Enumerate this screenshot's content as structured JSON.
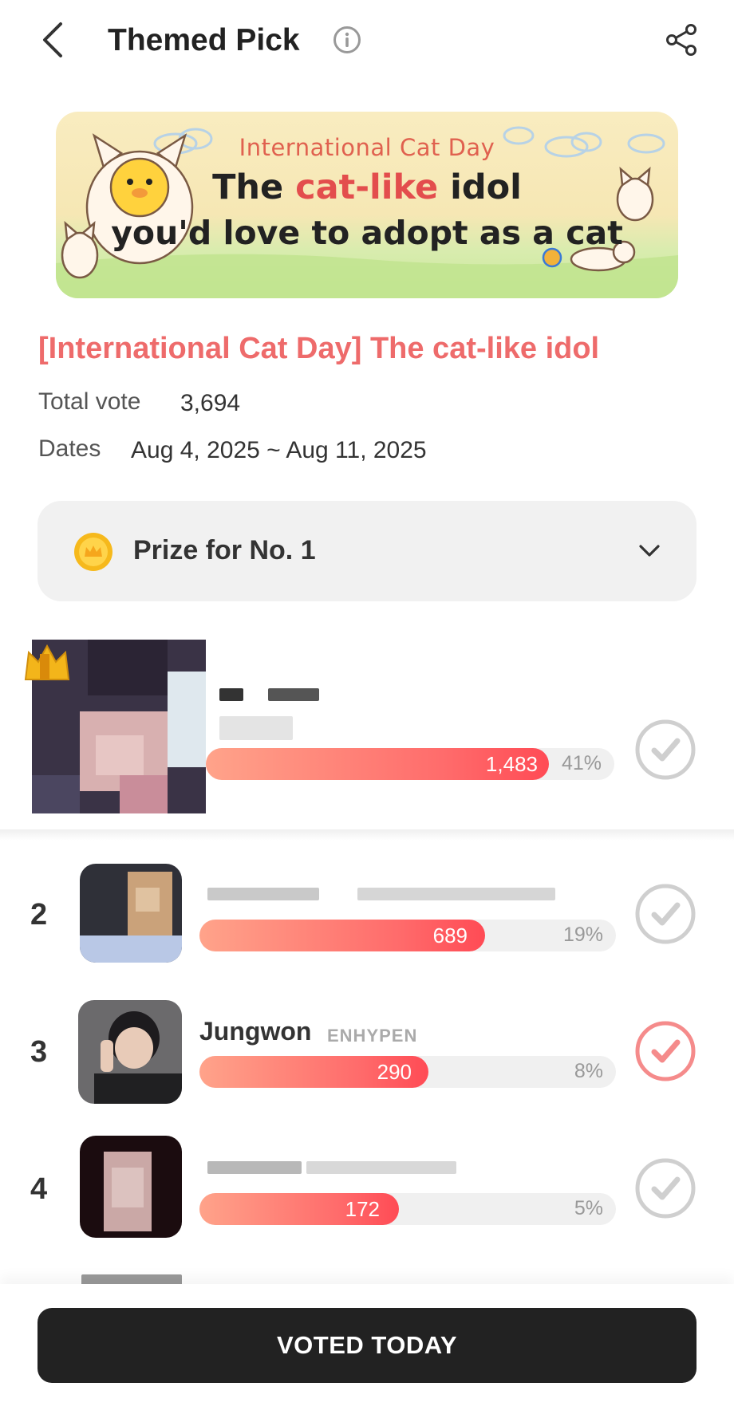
{
  "header": {
    "title": "Themed Pick"
  },
  "banner": {
    "line1": "International Cat Day",
    "line2_a": "The ",
    "line2_hl": "cat-like",
    "line2_b": " idol",
    "line3": "you'd love to adopt as a cat"
  },
  "pick": {
    "title": "[International Cat Day] The cat-like idol",
    "total_label": "Total vote",
    "total_value": "3,694",
    "dates_label": "Dates",
    "dates_value": "Aug 4, 2025 ~ Aug 11, 2025"
  },
  "prize": {
    "label": "Prize for No. 1"
  },
  "entries": [
    {
      "rank": "1",
      "name": "",
      "group": "",
      "votes": "1,483",
      "percent": "41%",
      "fraction": 0.41,
      "voted": false
    },
    {
      "rank": "2",
      "name": "",
      "group": "",
      "votes": "689",
      "percent": "19%",
      "fraction": 0.19,
      "voted": false
    },
    {
      "rank": "3",
      "name": "Jungwon",
      "group": "ENHYPEN",
      "votes": "290",
      "percent": "8%",
      "fraction": 0.08,
      "voted": true
    },
    {
      "rank": "4",
      "name": "",
      "group": "",
      "votes": "172",
      "percent": "5%",
      "fraction": 0.05,
      "voted": false
    }
  ],
  "footer": {
    "button_label": "VOTED TODAY"
  },
  "colors": {
    "accent": "#ee6b6b",
    "button": "#222222",
    "check_inactive": "#cccccc",
    "check_active": "#f58b8b"
  },
  "icons": [
    "back-arrow-icon",
    "info-icon",
    "share-icon",
    "coin-icon",
    "chevron-down-icon",
    "check-icon",
    "crown-icon"
  ]
}
